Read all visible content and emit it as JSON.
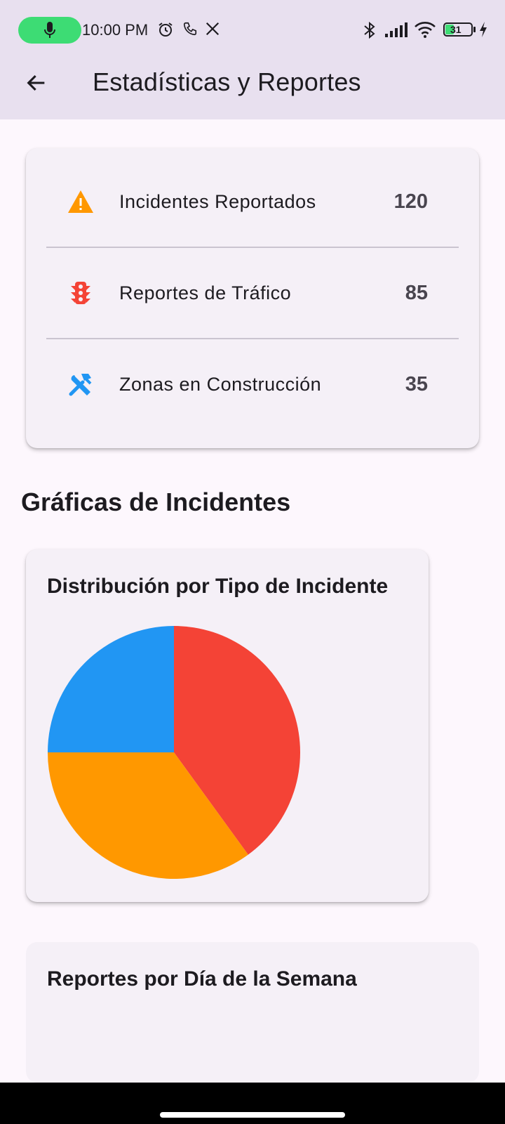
{
  "status_bar": {
    "time": "10:00 PM",
    "battery": "31",
    "icons": [
      "mic-icon",
      "alarm-icon",
      "phone-icon",
      "x-logo-icon",
      "bluetooth-icon",
      "signal-icon",
      "wifi-icon",
      "battery-icon",
      "charging-icon"
    ]
  },
  "app_bar": {
    "title": "Estadísticas y Reportes",
    "back_icon": "arrow-back-icon"
  },
  "stats": [
    {
      "label": "Incidentes Reportados",
      "value": "120",
      "icon": "warning-icon",
      "color": "#ff9800"
    },
    {
      "label": "Reportes de Tráfico",
      "value": "85",
      "icon": "traffic-light-icon",
      "color": "#f44336"
    },
    {
      "label": "Zonas en Construcción",
      "value": "35",
      "icon": "construction-icon",
      "color": "#2196f3"
    }
  ],
  "section": {
    "title": "Gráficas de Incidentes"
  },
  "pie_card": {
    "title": "Distribución por Tipo de Incidente"
  },
  "bar_card": {
    "title": "Reportes por Día de la Semana"
  },
  "chart_data": {
    "type": "pie",
    "title": "Distribución por Tipo de Incidente",
    "slices": [
      {
        "value": 40,
        "color": "#f44336"
      },
      {
        "value": 35,
        "color": "#ff9800"
      },
      {
        "value": 25,
        "color": "#2196f3"
      }
    ],
    "start_angle_deg": 0,
    "direction": "clockwise-from-top"
  }
}
